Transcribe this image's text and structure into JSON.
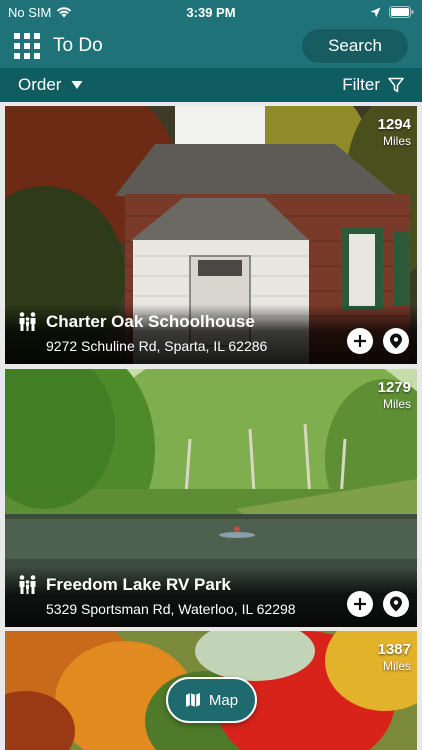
{
  "status_bar": {
    "carrier": "No SIM",
    "time": "3:39 PM"
  },
  "nav": {
    "title": "To Do",
    "search_label": "Search",
    "menu_icon": "grid-menu-icon"
  },
  "sort_bar": {
    "order_label": "Order",
    "filter_label": "Filter"
  },
  "cards": [
    {
      "distance": "1294",
      "unit": "Miles",
      "name": "Charter Oak Schoolhouse",
      "address": "9272 Schuline Rd, Sparta, IL 62286",
      "icon": "family-icon"
    },
    {
      "distance": "1279",
      "unit": "Miles",
      "name": "Freedom Lake RV Park",
      "address": "5329 Sportsman Rd, Waterloo, IL 62298",
      "icon": "family-icon"
    },
    {
      "distance": "1387",
      "unit": "Miles"
    }
  ],
  "map_button": {
    "label": "Map"
  },
  "colors": {
    "primary": "#1f7378",
    "primary_dark": "#0f5d60"
  }
}
